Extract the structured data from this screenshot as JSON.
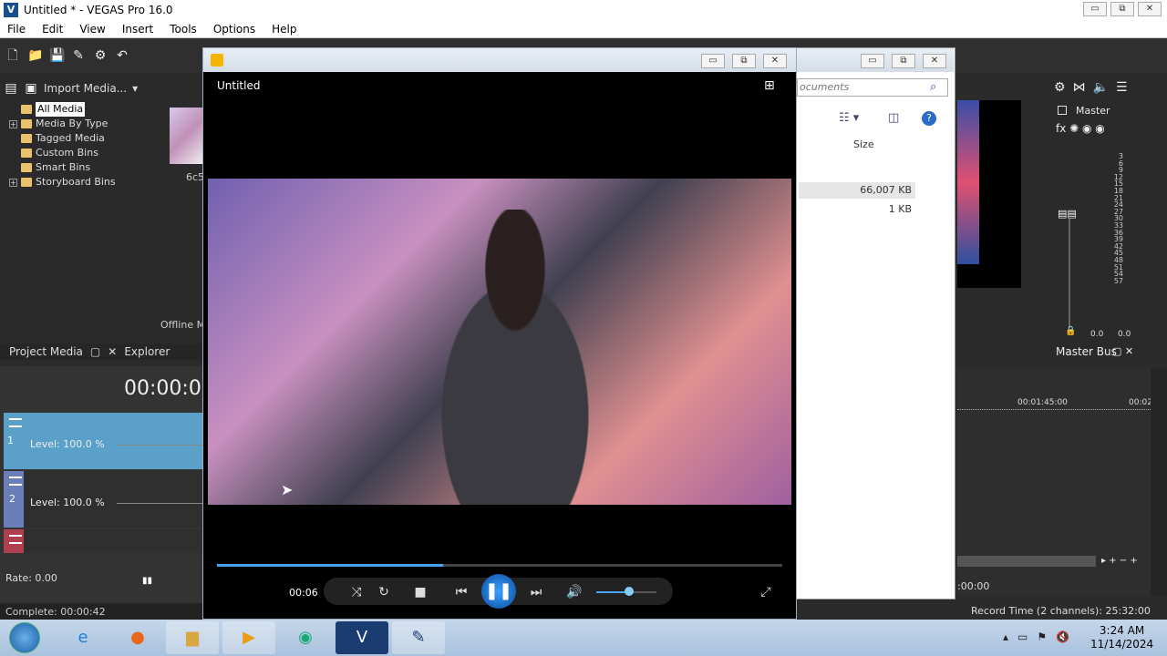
{
  "app": {
    "title": "Untitled * - VEGAS Pro 16.0",
    "logo_letter": "V"
  },
  "window_buttons": {
    "min": "▭",
    "max": "⧉",
    "close": "✕"
  },
  "menu": [
    "File",
    "Edit",
    "View",
    "Insert",
    "Tools",
    "Options",
    "Help"
  ],
  "project_media": {
    "import_label": "Import Media...",
    "tree": [
      "All Media",
      "Media By Type",
      "Tagged Media",
      "Custom Bins",
      "Smart Bins",
      "Storyboard Bins"
    ],
    "thumb_label": "6c5",
    "offline_label": "Offline M",
    "tabs": [
      "Project Media",
      "Explorer"
    ]
  },
  "timeline": {
    "timecode": "00:00:00:",
    "tracks": [
      {
        "num": "1",
        "level": "Level: 100.0 %",
        "color": "#5aa0c8"
      },
      {
        "num": "2",
        "level": "Level: 100.0 %",
        "color": "#6a7fb8"
      },
      {
        "num": "",
        "level": "",
        "color": "#b04050"
      }
    ],
    "rate": "Rate: 0.00",
    "complete": "Complete: 00:00:42",
    "ruler_marks": [
      "00:01:45:00",
      "00:02"
    ],
    "right_time": ":00:00",
    "record_time": "Record Time (2 channels): 25:32:00"
  },
  "explorer": {
    "search_placeholder": "ocuments",
    "column_size": "Size",
    "rows": [
      "66,007 KB",
      "1 KB"
    ]
  },
  "mixer": {
    "master": "Master",
    "master_bus": "Master Bus",
    "scale": [
      "3",
      "6",
      "9",
      "12",
      "15",
      "18",
      "21",
      "24",
      "27",
      "30",
      "33",
      "36",
      "39",
      "42",
      "45",
      "48",
      "51",
      "54",
      "57"
    ],
    "levels": [
      "0.0",
      "0.0"
    ]
  },
  "player": {
    "title": "Untitled",
    "time": "00:06",
    "progress": 0.4,
    "volume": 0.55
  },
  "taskbar": {
    "clock_time": "3:24 AM",
    "clock_date": "11/14/2024"
  }
}
